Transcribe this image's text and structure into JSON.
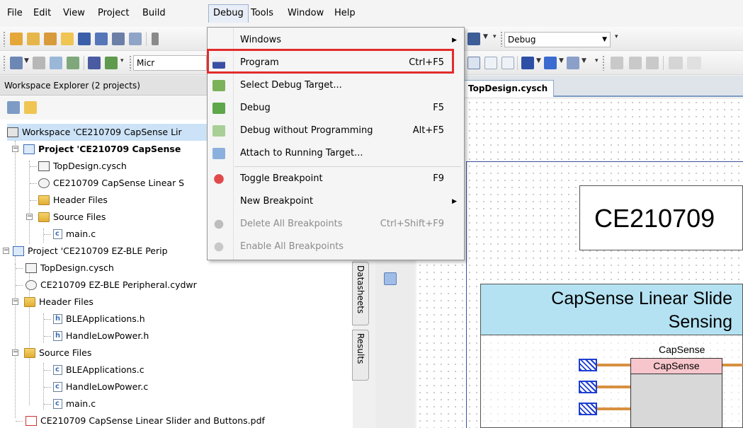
{
  "menubar": {
    "items": [
      {
        "label": "File"
      },
      {
        "label": "Edit"
      },
      {
        "label": "View"
      },
      {
        "label": "Project"
      },
      {
        "label": "Build"
      },
      {
        "label": "Debug"
      },
      {
        "label": "Tools"
      },
      {
        "label": "Window"
      },
      {
        "label": "Help"
      }
    ]
  },
  "toolbar1": {
    "configuration_combo": "Debug"
  },
  "toolbar2": {
    "partial_combo_text": "Micr"
  },
  "workspace_explorer": {
    "title": "Workspace Explorer (2 projects)",
    "tree": [
      {
        "label": "Workspace 'CE210709 CapSense Lir",
        "icon": "workspace-icon"
      },
      {
        "label": "Project  'CE210709 CapSense",
        "icon": "project-icon",
        "bold": true
      },
      {
        "label": "TopDesign.cysch",
        "icon": "schematic-icon"
      },
      {
        "label": "CE210709 CapSense Linear S",
        "icon": "design-wide-resources-icon"
      },
      {
        "label": "Header Files",
        "icon": "folder-icon"
      },
      {
        "label": "Source Files",
        "icon": "folder-icon"
      },
      {
        "label": "main.c",
        "icon": "c-file-icon"
      },
      {
        "label": "Project  'CE210709 EZ-BLE Perip",
        "icon": "project-icon"
      },
      {
        "label": "TopDesign.cysch",
        "icon": "schematic-icon"
      },
      {
        "label": "CE210709 EZ-BLE Peripheral.cydwr",
        "icon": "design-wide-resources-icon"
      },
      {
        "label": "Header Files",
        "icon": "folder-icon"
      },
      {
        "label": "BLEApplications.h",
        "icon": "h-file-icon"
      },
      {
        "label": "HandleLowPower.h",
        "icon": "h-file-icon"
      },
      {
        "label": "Source Files",
        "icon": "folder-icon"
      },
      {
        "label": "BLEApplications.c",
        "icon": "c-file-icon"
      },
      {
        "label": "HandleLowPower.c",
        "icon": "c-file-icon"
      },
      {
        "label": "main.c",
        "icon": "c-file-icon"
      },
      {
        "label": "CE210709 CapSense Linear Slider and Buttons.pdf",
        "icon": "pdf-icon"
      }
    ]
  },
  "side_tabs": {
    "datasheets": "Datasheets",
    "results": "Results"
  },
  "editor": {
    "tab_label": "TopDesign.cysch",
    "schematic": {
      "title_text": "CE210709",
      "slider_header_line1": "CapSense Linear Slide",
      "slider_header_line2": "Sensing",
      "component_caption": "CapSense",
      "component_title": "CapSense"
    }
  },
  "debug_menu": {
    "items": [
      {
        "label": "Windows",
        "shortcut": "",
        "submenu": true,
        "disabled": false,
        "icon": ""
      },
      {
        "label": "Program",
        "shortcut": "Ctrl+F5",
        "submenu": false,
        "disabled": false,
        "icon": "program-chip-icon"
      },
      {
        "label": "Select Debug Target...",
        "shortcut": "",
        "submenu": false,
        "disabled": false,
        "icon": "select-target-icon"
      },
      {
        "label": "Debug",
        "shortcut": "F5",
        "submenu": false,
        "disabled": false,
        "icon": "debug-bug-icon"
      },
      {
        "label": "Debug without Programming",
        "shortcut": "Alt+F5",
        "submenu": false,
        "disabled": false,
        "icon": "debug-noprog-icon"
      },
      {
        "label": "Attach to Running Target...",
        "shortcut": "",
        "submenu": false,
        "disabled": false,
        "icon": "attach-icon"
      },
      {
        "label": "Toggle Breakpoint",
        "shortcut": "F9",
        "submenu": false,
        "disabled": false,
        "icon": "breakpoint-icon"
      },
      {
        "label": "New Breakpoint",
        "shortcut": "",
        "submenu": true,
        "disabled": false,
        "icon": ""
      },
      {
        "label": "Delete All Breakpoints",
        "shortcut": "Ctrl+Shift+F9",
        "submenu": false,
        "disabled": true,
        "icon": "delete-breakpoints-icon"
      },
      {
        "label": "Enable All Breakpoints",
        "shortcut": "",
        "submenu": false,
        "disabled": true,
        "icon": "enable-breakpoints-icon"
      }
    ]
  },
  "colors": {
    "highlight_box": "#e22c2c",
    "slider_header": "#b4e2f2",
    "component_header": "#f7c6cc",
    "wire": "#d89040"
  }
}
